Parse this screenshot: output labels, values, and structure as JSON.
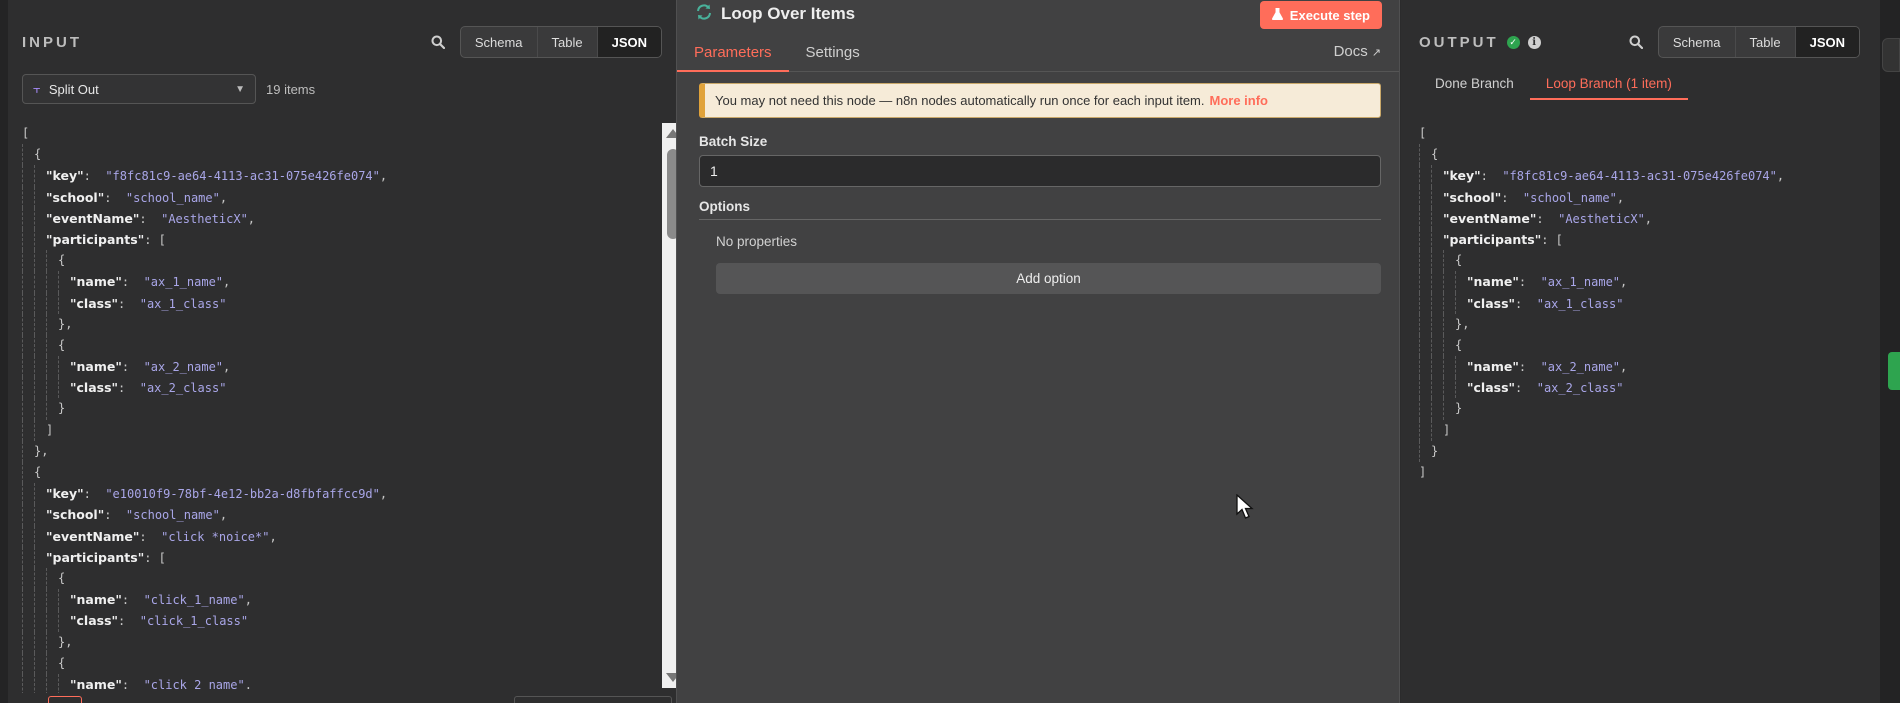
{
  "input_panel": {
    "title": "INPUT",
    "view_modes": [
      "Schema",
      "Table",
      "JSON"
    ],
    "active_view": "JSON",
    "node_select": "Split Out",
    "items_count": "19 items"
  },
  "node": {
    "title": "Loop Over Items",
    "execute_label": "Execute step",
    "tabs": [
      "Parameters",
      "Settings"
    ],
    "active_tab": "Parameters",
    "docs_label": "Docs",
    "notice_text": "You may not need this node — n8n nodes automatically run once for each input item.",
    "notice_link": "More info",
    "batch_size_label": "Batch Size",
    "batch_size_value": "1",
    "options_label": "Options",
    "no_properties": "No properties",
    "add_option_label": "Add option"
  },
  "output_panel": {
    "title": "OUTPUT",
    "view_modes": [
      "Schema",
      "Table",
      "JSON"
    ],
    "active_view": "JSON",
    "branches": [
      "Done Branch",
      "Loop Branch (1 item)"
    ],
    "active_branch": "Loop Branch (1 item)"
  },
  "input_json_lines": [
    {
      "indent": 0,
      "parts": [
        [
          "p",
          "["
        ]
      ]
    },
    {
      "indent": 1,
      "parts": [
        [
          "p",
          "{"
        ]
      ]
    },
    {
      "indent": 2,
      "parts": [
        [
          "k",
          "\"key\""
        ],
        [
          "p",
          ":  "
        ],
        [
          "s",
          "\"f8fc81c9-ae64-4113-ac31-075e426fe074\""
        ],
        [
          "p",
          ","
        ]
      ]
    },
    {
      "indent": 2,
      "parts": [
        [
          "k",
          "\"school\""
        ],
        [
          "p",
          ":  "
        ],
        [
          "s",
          "\"school_name\""
        ],
        [
          "p",
          ","
        ]
      ]
    },
    {
      "indent": 2,
      "parts": [
        [
          "k",
          "\"eventName\""
        ],
        [
          "p",
          ":  "
        ],
        [
          "s",
          "\"AestheticX\""
        ],
        [
          "p",
          ","
        ]
      ]
    },
    {
      "indent": 2,
      "parts": [
        [
          "k",
          "\"participants\""
        ],
        [
          "p",
          ": ["
        ]
      ]
    },
    {
      "indent": 3,
      "parts": [
        [
          "p",
          "{"
        ]
      ]
    },
    {
      "indent": 4,
      "parts": [
        [
          "k",
          "\"name\""
        ],
        [
          "p",
          ":  "
        ],
        [
          "s",
          "\"ax_1_name\""
        ],
        [
          "p",
          ","
        ]
      ]
    },
    {
      "indent": 4,
      "parts": [
        [
          "k",
          "\"class\""
        ],
        [
          "p",
          ":  "
        ],
        [
          "s",
          "\"ax_1_class\""
        ]
      ]
    },
    {
      "indent": 3,
      "parts": [
        [
          "p",
          "},"
        ]
      ]
    },
    {
      "indent": 3,
      "parts": [
        [
          "p",
          "{"
        ]
      ]
    },
    {
      "indent": 4,
      "parts": [
        [
          "k",
          "\"name\""
        ],
        [
          "p",
          ":  "
        ],
        [
          "s",
          "\"ax_2_name\""
        ],
        [
          "p",
          ","
        ]
      ]
    },
    {
      "indent": 4,
      "parts": [
        [
          "k",
          "\"class\""
        ],
        [
          "p",
          ":  "
        ],
        [
          "s",
          "\"ax_2_class\""
        ]
      ]
    },
    {
      "indent": 3,
      "parts": [
        [
          "p",
          "}"
        ]
      ]
    },
    {
      "indent": 2,
      "parts": [
        [
          "p",
          "]"
        ]
      ]
    },
    {
      "indent": 1,
      "parts": [
        [
          "p",
          "},"
        ]
      ]
    },
    {
      "indent": 1,
      "parts": [
        [
          "p",
          "{"
        ]
      ]
    },
    {
      "indent": 2,
      "parts": [
        [
          "k",
          "\"key\""
        ],
        [
          "p",
          ":  "
        ],
        [
          "s",
          "\"e10010f9-78bf-4e12-bb2a-d8fbfaffcc9d\""
        ],
        [
          "p",
          ","
        ]
      ]
    },
    {
      "indent": 2,
      "parts": [
        [
          "k",
          "\"school\""
        ],
        [
          "p",
          ":  "
        ],
        [
          "s",
          "\"school_name\""
        ],
        [
          "p",
          ","
        ]
      ]
    },
    {
      "indent": 2,
      "parts": [
        [
          "k",
          "\"eventName\""
        ],
        [
          "p",
          ":  "
        ],
        [
          "s",
          "\"click *noice*\""
        ],
        [
          "p",
          ","
        ]
      ]
    },
    {
      "indent": 2,
      "parts": [
        [
          "k",
          "\"participants\""
        ],
        [
          "p",
          ": ["
        ]
      ]
    },
    {
      "indent": 3,
      "parts": [
        [
          "p",
          "{"
        ]
      ]
    },
    {
      "indent": 4,
      "parts": [
        [
          "k",
          "\"name\""
        ],
        [
          "p",
          ":  "
        ],
        [
          "s",
          "\"click_1_name\""
        ],
        [
          "p",
          ","
        ]
      ]
    },
    {
      "indent": 4,
      "parts": [
        [
          "k",
          "\"class\""
        ],
        [
          "p",
          ":  "
        ],
        [
          "s",
          "\"click_1_class\""
        ]
      ]
    },
    {
      "indent": 3,
      "parts": [
        [
          "p",
          "},"
        ]
      ]
    },
    {
      "indent": 3,
      "parts": [
        [
          "p",
          "{"
        ]
      ]
    },
    {
      "indent": 4,
      "parts": [
        [
          "k",
          "\"name\""
        ],
        [
          "p",
          ":  "
        ],
        [
          "s",
          "\"click 2 name\""
        ],
        [
          "p",
          "."
        ]
      ]
    }
  ],
  "output_json_lines": [
    {
      "indent": 0,
      "parts": [
        [
          "p",
          "["
        ]
      ]
    },
    {
      "indent": 1,
      "parts": [
        [
          "p",
          "{"
        ]
      ]
    },
    {
      "indent": 2,
      "parts": [
        [
          "k",
          "\"key\""
        ],
        [
          "p",
          ":  "
        ],
        [
          "s",
          "\"f8fc81c9-ae64-4113-ac31-075e426fe074\""
        ],
        [
          "p",
          ","
        ]
      ]
    },
    {
      "indent": 2,
      "parts": [
        [
          "k",
          "\"school\""
        ],
        [
          "p",
          ":  "
        ],
        [
          "s",
          "\"school_name\""
        ],
        [
          "p",
          ","
        ]
      ]
    },
    {
      "indent": 2,
      "parts": [
        [
          "k",
          "\"eventName\""
        ],
        [
          "p",
          ":  "
        ],
        [
          "s",
          "\"AestheticX\""
        ],
        [
          "p",
          ","
        ]
      ]
    },
    {
      "indent": 2,
      "parts": [
        [
          "k",
          "\"participants\""
        ],
        [
          "p",
          ": ["
        ]
      ]
    },
    {
      "indent": 3,
      "parts": [
        [
          "p",
          "{"
        ]
      ]
    },
    {
      "indent": 4,
      "parts": [
        [
          "k",
          "\"name\""
        ],
        [
          "p",
          ":  "
        ],
        [
          "s",
          "\"ax_1_name\""
        ],
        [
          "p",
          ","
        ]
      ]
    },
    {
      "indent": 4,
      "parts": [
        [
          "k",
          "\"class\""
        ],
        [
          "p",
          ":  "
        ],
        [
          "s",
          "\"ax_1_class\""
        ]
      ]
    },
    {
      "indent": 3,
      "parts": [
        [
          "p",
          "},"
        ]
      ]
    },
    {
      "indent": 3,
      "parts": [
        [
          "p",
          "{"
        ]
      ]
    },
    {
      "indent": 4,
      "parts": [
        [
          "k",
          "\"name\""
        ],
        [
          "p",
          ":  "
        ],
        [
          "s",
          "\"ax_2_name\""
        ],
        [
          "p",
          ","
        ]
      ]
    },
    {
      "indent": 4,
      "parts": [
        [
          "k",
          "\"class\""
        ],
        [
          "p",
          ":  "
        ],
        [
          "s",
          "\"ax_2_class\""
        ]
      ]
    },
    {
      "indent": 3,
      "parts": [
        [
          "p",
          "}"
        ]
      ]
    },
    {
      "indent": 2,
      "parts": [
        [
          "p",
          "]"
        ]
      ]
    },
    {
      "indent": 1,
      "parts": [
        [
          "p",
          "}"
        ]
      ]
    },
    {
      "indent": 0,
      "parts": [
        [
          "p",
          "]"
        ]
      ]
    }
  ],
  "colors": {
    "accent": "#ff6d5a",
    "success": "#2ea44f",
    "string_value": "#a9a6e8",
    "loop_icon": "#49b29b"
  },
  "icons": {
    "search": "search-icon",
    "loop": "loop-icon",
    "flask": "flask-icon",
    "external_link": "external-link-icon",
    "check": "check-circle-icon",
    "info": "info-icon",
    "split_out": "split-out-icon",
    "chevron": "chevron-down-icon"
  }
}
